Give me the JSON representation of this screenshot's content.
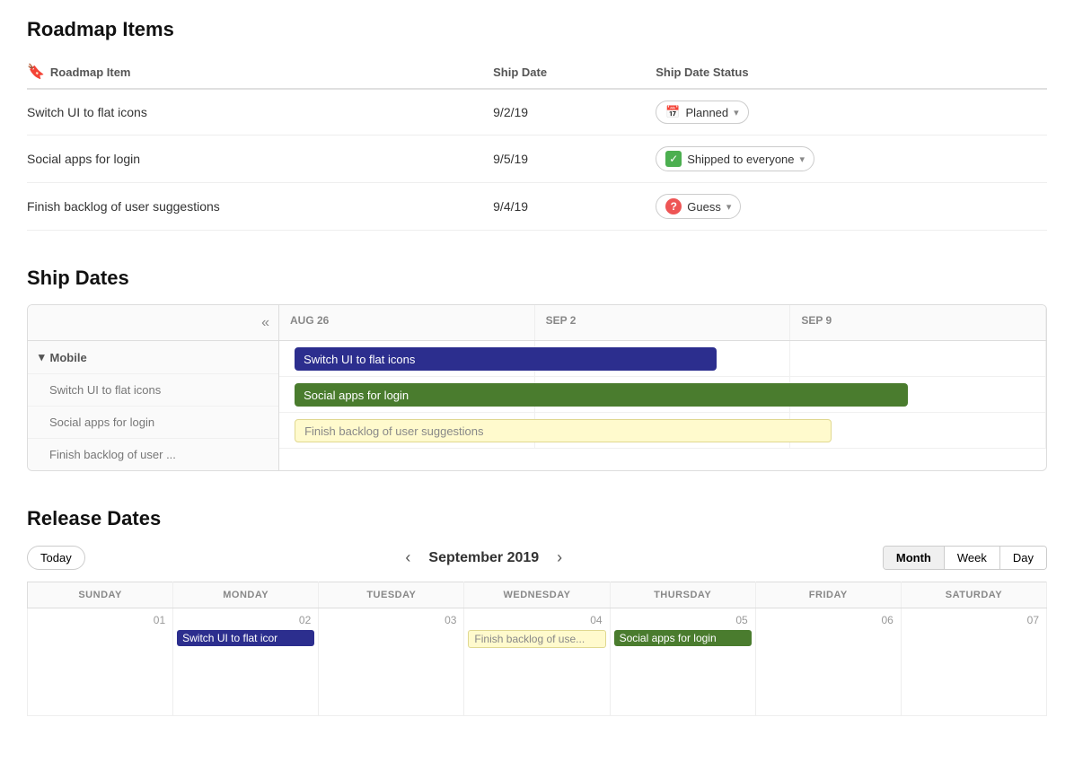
{
  "page": {
    "roadmap": {
      "title": "Roadmap Items",
      "columns": [
        {
          "id": "item",
          "label": "Roadmap Item",
          "icon": "bookmark"
        },
        {
          "id": "ship_date",
          "label": "Ship Date"
        },
        {
          "id": "status",
          "label": "Ship Date Status"
        }
      ],
      "rows": [
        {
          "item": "Switch UI to flat icons",
          "ship_date": "9/2/19",
          "status": "Planned",
          "status_type": "planned"
        },
        {
          "item": "Social apps for login",
          "ship_date": "9/5/19",
          "status": "Shipped to everyone",
          "status_type": "shipped"
        },
        {
          "item": "Finish backlog of user suggestions",
          "ship_date": "9/4/19",
          "status": "Guess",
          "status_type": "guess"
        }
      ]
    },
    "ship_dates": {
      "title": "Ship Dates",
      "collapse_label": "«",
      "group": "Mobile",
      "items": [
        "Switch UI to flat icons",
        "Social apps for login",
        "Finish backlog of user ..."
      ],
      "columns": [
        "AUG 26",
        "SEP 2",
        "SEP 9"
      ],
      "bars": [
        {
          "label": "Switch UI to flat icons",
          "type": "blue",
          "left_pct": 2,
          "width_pct": 55
        },
        {
          "label": "Social apps for login",
          "type": "green",
          "left_pct": 2,
          "width_pct": 80
        },
        {
          "label": "Finish backlog of user suggestions",
          "type": "yellow",
          "left_pct": 2,
          "width_pct": 70
        }
      ]
    },
    "release_dates": {
      "title": "Release Dates",
      "today_label": "Today",
      "month": "September 2019",
      "view_options": [
        "Month",
        "Week",
        "Day"
      ],
      "active_view": "Month",
      "days_of_week": [
        "SUNDAY",
        "MONDAY",
        "TUESDAY",
        "WEDNESDAY",
        "THURSDAY",
        "FRIDAY",
        "SATURDAY"
      ],
      "weeks": [
        {
          "days": [
            {
              "num": "01",
              "events": []
            },
            {
              "num": "02",
              "events": [
                {
                  "label": "Switch UI to flat icor",
                  "type": "blue"
                }
              ]
            },
            {
              "num": "03",
              "events": []
            },
            {
              "num": "04",
              "events": [
                {
                  "label": "Finish backlog of use...",
                  "type": "yellow"
                }
              ]
            },
            {
              "num": "05",
              "events": [
                {
                  "label": "Social apps for login",
                  "type": "green"
                }
              ]
            },
            {
              "num": "06",
              "events": []
            },
            {
              "num": "07",
              "events": []
            }
          ]
        }
      ]
    }
  }
}
